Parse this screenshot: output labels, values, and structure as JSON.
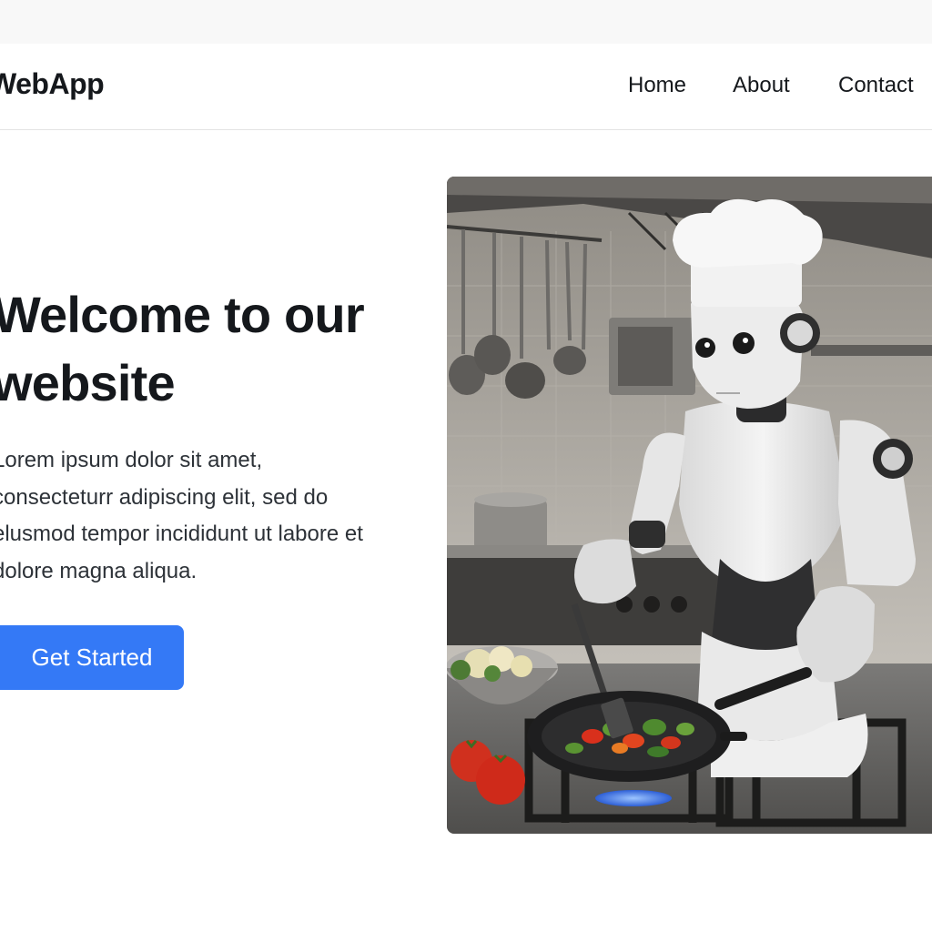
{
  "navbar": {
    "brand": "WebApp",
    "links": [
      "Home",
      "About",
      "Contact"
    ]
  },
  "hero": {
    "title": "Welcome to our website",
    "text": "Lorem ipsum dolor sit amet, consecteturr adipiscing elit, sed do elusmod tempor incididunt ut labore et dolore magna aliqua.",
    "cta": "Get Started",
    "image": {
      "subject": "robot-chef-cooking-vegetables"
    }
  },
  "colors": {
    "accent": "#3479f6",
    "text": "#15181c",
    "background": "#ffffff",
    "top_strip": "#f8f8f8"
  }
}
